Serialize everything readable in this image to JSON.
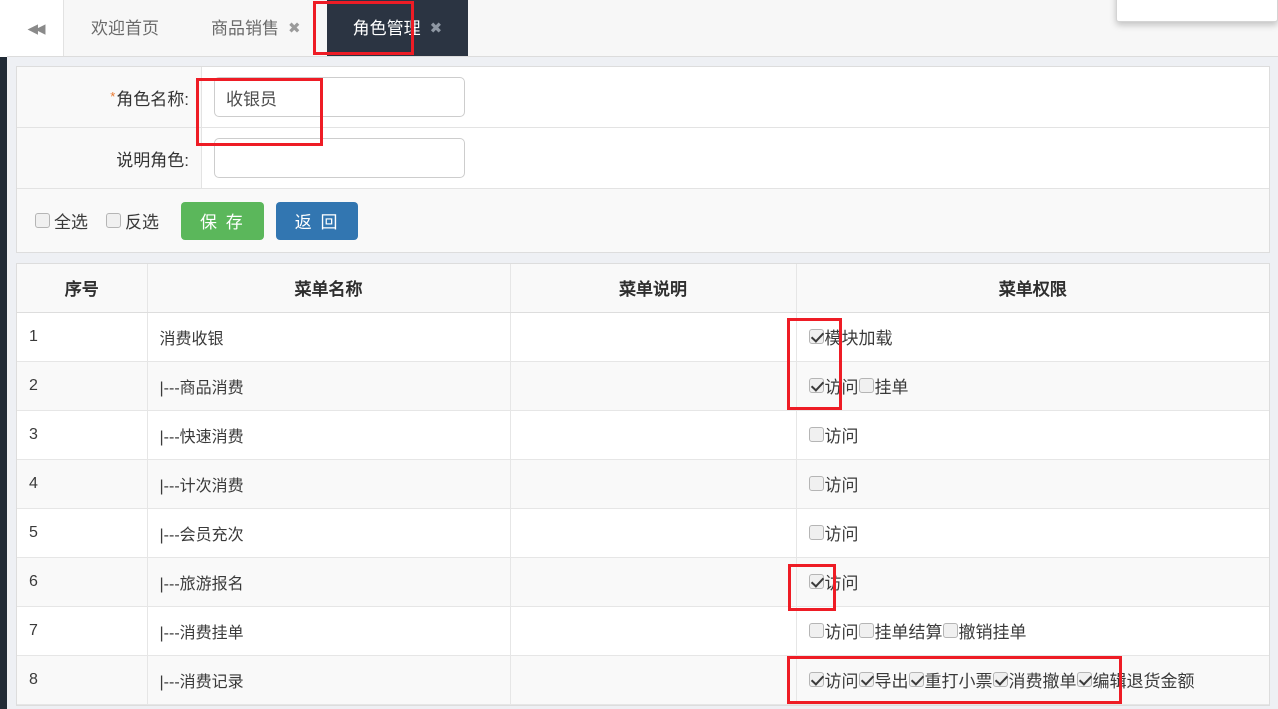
{
  "tabbar": {
    "collapse_icon": "double-chevron-left",
    "tabs": [
      {
        "label": "欢迎首页",
        "closable": false,
        "active": false
      },
      {
        "label": "商品销售",
        "closable": true,
        "active": false,
        "close_glyph": "✖"
      },
      {
        "label": "角色管理",
        "closable": true,
        "active": true,
        "close_glyph": "✖"
      }
    ]
  },
  "form": {
    "role_name": {
      "required_mark": "*",
      "label": "角色名称:",
      "value": "收银员",
      "placeholder": ""
    },
    "role_desc": {
      "label": "说明角色:",
      "value": "",
      "placeholder": ""
    }
  },
  "actions": {
    "select_all": {
      "label": "全选",
      "checked": false
    },
    "invert": {
      "label": "反选",
      "checked": false
    },
    "save": {
      "label": "保 存",
      "color": "#5bb75b"
    },
    "back": {
      "label": "返 回",
      "color": "#3276b1"
    }
  },
  "table": {
    "headers": [
      "序号",
      "菜单名称",
      "菜单说明",
      "菜单权限"
    ],
    "rows": [
      {
        "idx": "1",
        "name": "消费收银",
        "indent": false,
        "desc": "",
        "perms": [
          {
            "label": "模块加载",
            "checked": true
          }
        ]
      },
      {
        "idx": "2",
        "name": "|---商品消费",
        "indent": true,
        "desc": "",
        "perms": [
          {
            "label": "访问",
            "checked": true
          },
          {
            "label": "挂单",
            "checked": false
          }
        ]
      },
      {
        "idx": "3",
        "name": "|---快速消费",
        "indent": true,
        "desc": "",
        "perms": [
          {
            "label": "访问",
            "checked": false
          }
        ]
      },
      {
        "idx": "4",
        "name": "|---计次消费",
        "indent": true,
        "desc": "",
        "perms": [
          {
            "label": "访问",
            "checked": false
          }
        ]
      },
      {
        "idx": "5",
        "name": "|---会员充次",
        "indent": true,
        "desc": "",
        "perms": [
          {
            "label": "访问",
            "checked": false
          }
        ]
      },
      {
        "idx": "6",
        "name": "|---旅游报名",
        "indent": true,
        "desc": "",
        "perms": [
          {
            "label": "访问",
            "checked": true
          }
        ]
      },
      {
        "idx": "7",
        "name": "|---消费挂单",
        "indent": true,
        "desc": "",
        "perms": [
          {
            "label": "访问",
            "checked": false
          },
          {
            "label": "挂单结算",
            "checked": false
          },
          {
            "label": "撤销挂单",
            "checked": false
          }
        ]
      },
      {
        "idx": "8",
        "name": "|---消费记录",
        "indent": true,
        "desc": "",
        "perms": [
          {
            "label": "访问",
            "checked": true
          },
          {
            "label": "导出",
            "checked": true
          },
          {
            "label": "重打小票",
            "checked": true
          },
          {
            "label": "消费撤单",
            "checked": true
          },
          {
            "label": "编辑退货金额",
            "checked": true
          }
        ]
      }
    ]
  },
  "annotations": {
    "color": "#ee1c25",
    "boxes": [
      "active-tab",
      "role-name-input",
      "row1-row2-permission",
      "row6-permission",
      "row8-permission"
    ]
  }
}
